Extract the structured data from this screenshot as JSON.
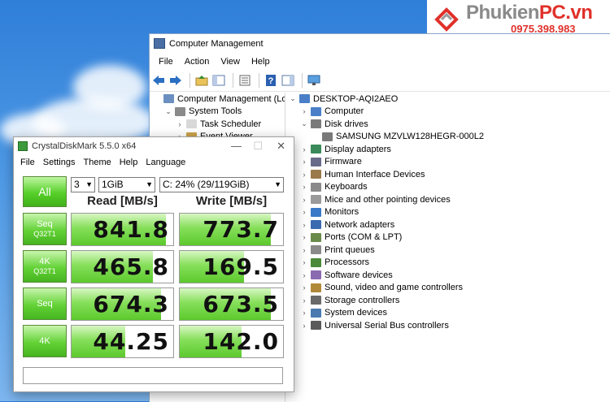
{
  "logo": {
    "name_prefix": "Phukien",
    "name_suffix": "PC.vn",
    "phone": "0975.398.983"
  },
  "colors": {
    "accent": "#e0312a",
    "bar_green": "#5cc92d",
    "desktop_blue": "#2f7ed8"
  },
  "computer_management": {
    "title": "Computer Management",
    "menu": [
      "File",
      "Action",
      "View",
      "Help"
    ],
    "toolbar_icons": [
      "back-arrow-icon",
      "forward-arrow-icon",
      "up-folder-icon",
      "show-hide-tree-icon",
      "properties-icon",
      "help-icon",
      "action-pane-icon",
      "monitor-icon"
    ],
    "left_tree": [
      {
        "label": "Computer Management (Local",
        "level": 0,
        "expander": "",
        "icon": "computer-management-icon"
      },
      {
        "label": "System Tools",
        "level": 1,
        "expander": "down",
        "icon": "tools-icon"
      },
      {
        "label": "Task Scheduler",
        "level": 2,
        "expander": "right",
        "icon": "clock-icon"
      },
      {
        "label": "Event Viewer",
        "level": 2,
        "expander": "right",
        "icon": "event-viewer-icon"
      }
    ],
    "device_tree": [
      {
        "label": "DESKTOP-AQI2AEO",
        "level": 0,
        "expander": "down",
        "icon": "computer-icon"
      },
      {
        "label": "Computer",
        "level": 1,
        "expander": "right",
        "icon": "computer-icon"
      },
      {
        "label": "Disk drives",
        "level": 1,
        "expander": "down",
        "icon": "disk-drive-icon"
      },
      {
        "label": "SAMSUNG MZVLW128HEGR-000L2",
        "level": 2,
        "expander": "",
        "icon": "disk-drive-icon"
      },
      {
        "label": "Display adapters",
        "level": 1,
        "expander": "right",
        "icon": "display-adapter-icon"
      },
      {
        "label": "Firmware",
        "level": 1,
        "expander": "right",
        "icon": "firmware-icon"
      },
      {
        "label": "Human Interface Devices",
        "level": 1,
        "expander": "right",
        "icon": "hid-icon"
      },
      {
        "label": "Keyboards",
        "level": 1,
        "expander": "right",
        "icon": "keyboard-icon"
      },
      {
        "label": "Mice and other pointing devices",
        "level": 1,
        "expander": "right",
        "icon": "mouse-icon"
      },
      {
        "label": "Monitors",
        "level": 1,
        "expander": "right",
        "icon": "monitor-icon"
      },
      {
        "label": "Network adapters",
        "level": 1,
        "expander": "right",
        "icon": "network-adapter-icon"
      },
      {
        "label": "Ports (COM & LPT)",
        "level": 1,
        "expander": "right",
        "icon": "port-icon"
      },
      {
        "label": "Print queues",
        "level": 1,
        "expander": "right",
        "icon": "printer-icon"
      },
      {
        "label": "Processors",
        "level": 1,
        "expander": "right",
        "icon": "processor-icon"
      },
      {
        "label": "Software devices",
        "level": 1,
        "expander": "right",
        "icon": "software-device-icon"
      },
      {
        "label": "Sound, video and game controllers",
        "level": 1,
        "expander": "right",
        "icon": "sound-icon"
      },
      {
        "label": "Storage controllers",
        "level": 1,
        "expander": "right",
        "icon": "storage-controller-icon"
      },
      {
        "label": "System devices",
        "level": 1,
        "expander": "right",
        "icon": "system-device-icon"
      },
      {
        "label": "Universal Serial Bus controllers",
        "level": 1,
        "expander": "right",
        "icon": "usb-icon"
      }
    ]
  },
  "crystaldiskmark": {
    "title": "CrystalDiskMark 5.5.0 x64",
    "menu": [
      "File",
      "Settings",
      "Theme",
      "Help",
      "Language"
    ],
    "all_label": "All",
    "count_value": "3",
    "size_value": "1GiB",
    "drive_value": "C: 24% (29/119GiB)",
    "read_header": "Read [MB/s]",
    "write_header": "Write [MB/s]",
    "rows": [
      {
        "label": "Seq",
        "sub": "Q32T1",
        "read": "841.8",
        "write": "773.7",
        "read_fill": 0.93,
        "write_fill": 0.88
      },
      {
        "label": "4K",
        "sub": "Q32T1",
        "read": "465.8",
        "write": "169.5",
        "read_fill": 0.8,
        "write_fill": 0.62
      },
      {
        "label": "Seq",
        "sub": "",
        "read": "674.3",
        "write": "673.5",
        "read_fill": 0.88,
        "write_fill": 0.88
      },
      {
        "label": "4K",
        "sub": "",
        "read": "44.25",
        "write": "142.0",
        "read_fill": 0.53,
        "write_fill": 0.6
      }
    ],
    "comment": ""
  }
}
